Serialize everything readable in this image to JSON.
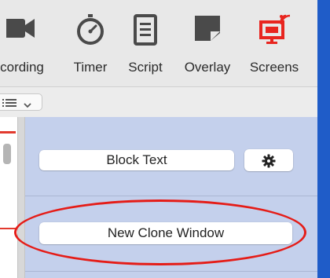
{
  "toolbar": {
    "recording_label": "cording",
    "timer_label": "Timer",
    "script_label": "Script",
    "overlay_label": "Overlay",
    "screens_label": "Screens"
  },
  "panel": {
    "block_text_label": "Block Text",
    "new_clone_window_label": "New Clone Window"
  },
  "colors": {
    "panel_background": "#c4d0ec",
    "screens_icon": "#e8251f",
    "annotation_oval": "#e51c17",
    "window_edge": "#1f5cc8"
  },
  "icons": {
    "recording": "video-camera-icon",
    "timer": "stopwatch-icon",
    "script": "document-icon",
    "overlay": "overlay-icon",
    "screens": "screens-broadcast-icon",
    "view_toggle": "list-view-icon",
    "settings": "gear-icon"
  }
}
